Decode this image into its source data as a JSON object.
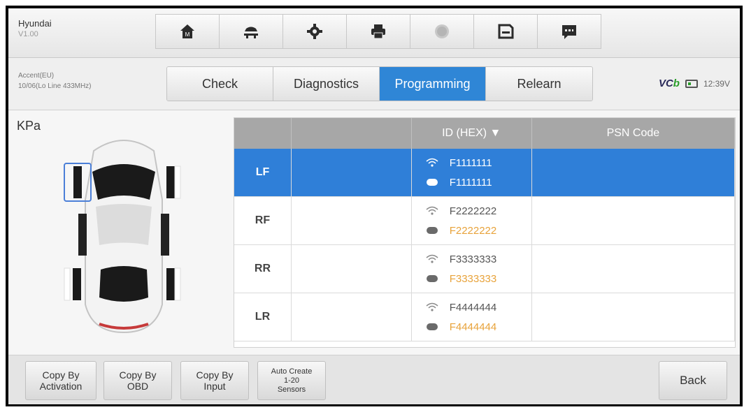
{
  "app": {
    "name": "Hyundai",
    "version": "V1.00"
  },
  "toolbar": [
    {
      "icon": "home-icon"
    },
    {
      "icon": "vehicle-lift-icon"
    },
    {
      "icon": "gear-icon"
    },
    {
      "icon": "printer-icon"
    },
    {
      "icon": "help-icon"
    },
    {
      "icon": "save-icon"
    },
    {
      "icon": "message-icon"
    }
  ],
  "vehicle": {
    "model": "Accent(EU)",
    "detail": "10/06(Lo Line 433MHz)"
  },
  "tabs": [
    {
      "label": "Check",
      "active": false
    },
    {
      "label": "Diagnostics",
      "active": false
    },
    {
      "label": "Programming",
      "active": true
    },
    {
      "label": "Relearn",
      "active": false
    }
  ],
  "status": {
    "vci_prefix": "VC",
    "vci_suffix": "b",
    "time": "12:39V"
  },
  "main": {
    "unit_label": "KPa"
  },
  "table": {
    "headers": [
      "",
      "",
      "ID (HEX) ▼",
      "PSN Code"
    ],
    "rows": [
      {
        "pos": "LF",
        "sensor_id": "F1111111",
        "obd_id": "F1111111",
        "selected": true
      },
      {
        "pos": "RF",
        "sensor_id": "F2222222",
        "obd_id": "F2222222",
        "selected": false
      },
      {
        "pos": "RR",
        "sensor_id": "F3333333",
        "obd_id": "F3333333",
        "selected": false
      },
      {
        "pos": "LR",
        "sensor_id": "F4444444",
        "obd_id": "F4444444",
        "selected": false
      }
    ]
  },
  "bottom": {
    "copy_activation": "Copy By\nActivation",
    "copy_obd": "Copy By\nOBD",
    "copy_input": "Copy By\nInput",
    "auto_create": "Auto Create\n1-20\nSensors",
    "back": "Back"
  },
  "colors": {
    "accent": "#2f7fd8",
    "highlight": "#e8a33b",
    "header": "#a7a7a7"
  }
}
